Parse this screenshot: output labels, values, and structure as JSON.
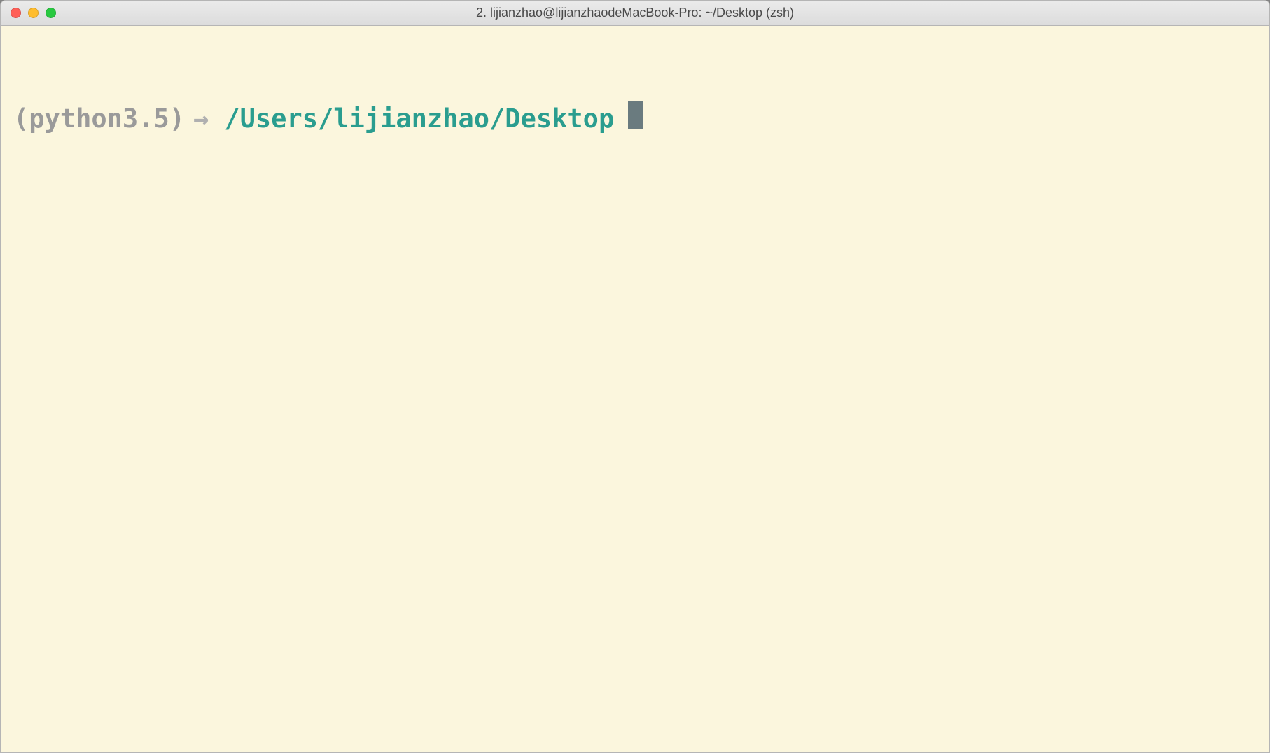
{
  "titlebar": {
    "title": "2. lijianzhao@lijianzhaodeMacBook-Pro: ~/Desktop (zsh)"
  },
  "prompt": {
    "venv": "(python3.5)",
    "arrow": "→",
    "cwd": "/Users/lijianzhao/Desktop"
  },
  "colors": {
    "bg": "#fbf6dd",
    "venv": "#9a9a9a",
    "cwd": "#2a9d8f",
    "cursor": "#6a7b7f"
  }
}
